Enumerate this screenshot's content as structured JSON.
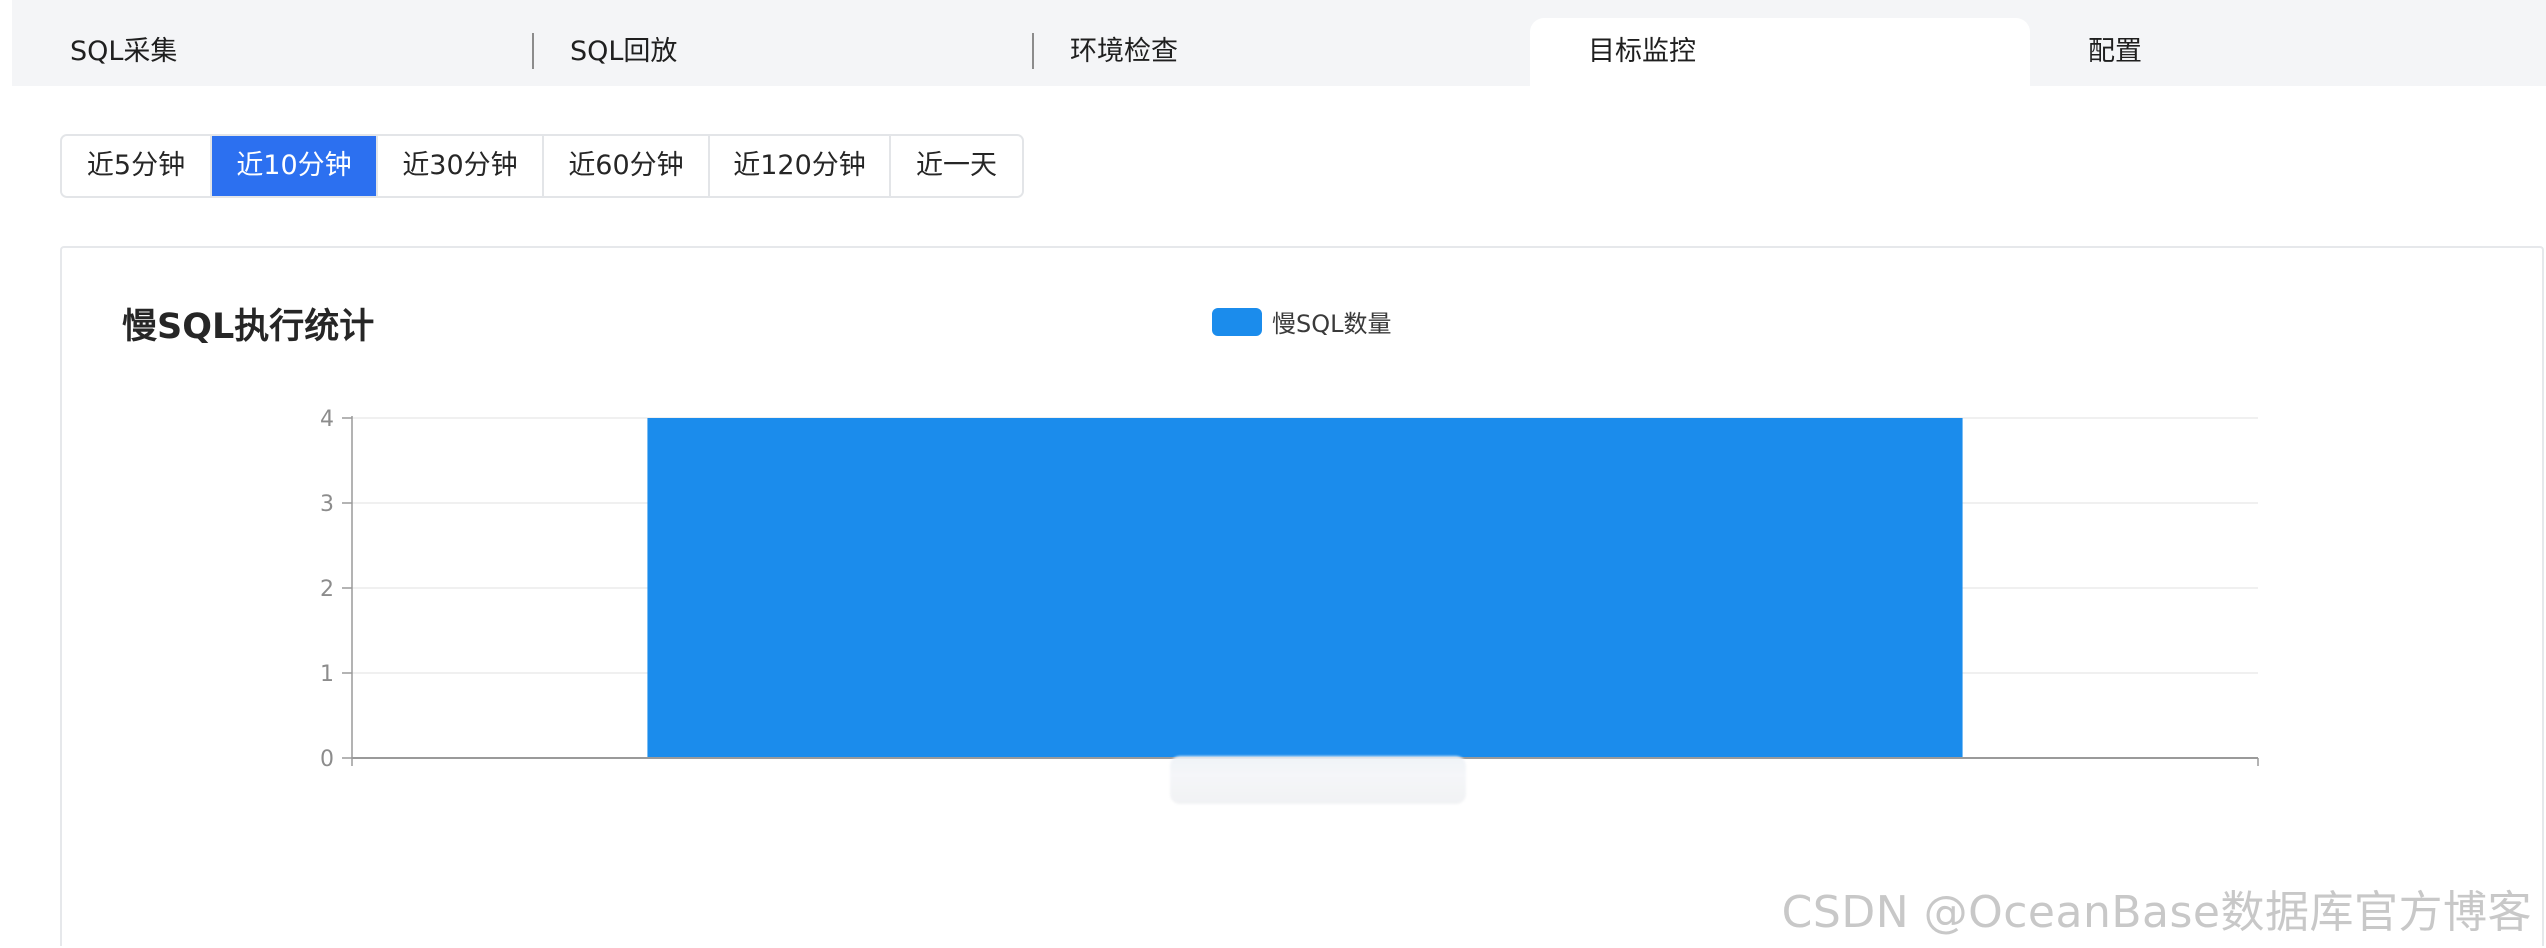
{
  "tabs": [
    {
      "label": "SQL采集",
      "active": false
    },
    {
      "label": "SQL回放",
      "active": false
    },
    {
      "label": "环境检查",
      "active": false
    },
    {
      "label": "目标监控",
      "active": true
    },
    {
      "label": "配置",
      "active": false
    }
  ],
  "time_ranges": [
    {
      "label": "近5分钟",
      "active": false
    },
    {
      "label": "近10分钟",
      "active": true
    },
    {
      "label": "近30分钟",
      "active": false
    },
    {
      "label": "近60分钟",
      "active": false
    },
    {
      "label": "近120分钟",
      "active": false
    },
    {
      "label": "近一天",
      "active": false
    }
  ],
  "chart_data": {
    "type": "bar",
    "title": "慢SQL执行统计",
    "categories": [
      ""
    ],
    "series": [
      {
        "name": "慢SQL数量",
        "values": [
          4
        ],
        "color": "#1b8cec"
      }
    ],
    "ylim": [
      0,
      4
    ],
    "yticks": [
      "0",
      "1",
      "2",
      "3",
      "4"
    ],
    "grid": true,
    "legend": "top-center"
  },
  "colors": {
    "accent": "#2c70f0",
    "bar": "#1b8cec"
  },
  "watermark": "CSDN @OceanBase数据库官方博客"
}
